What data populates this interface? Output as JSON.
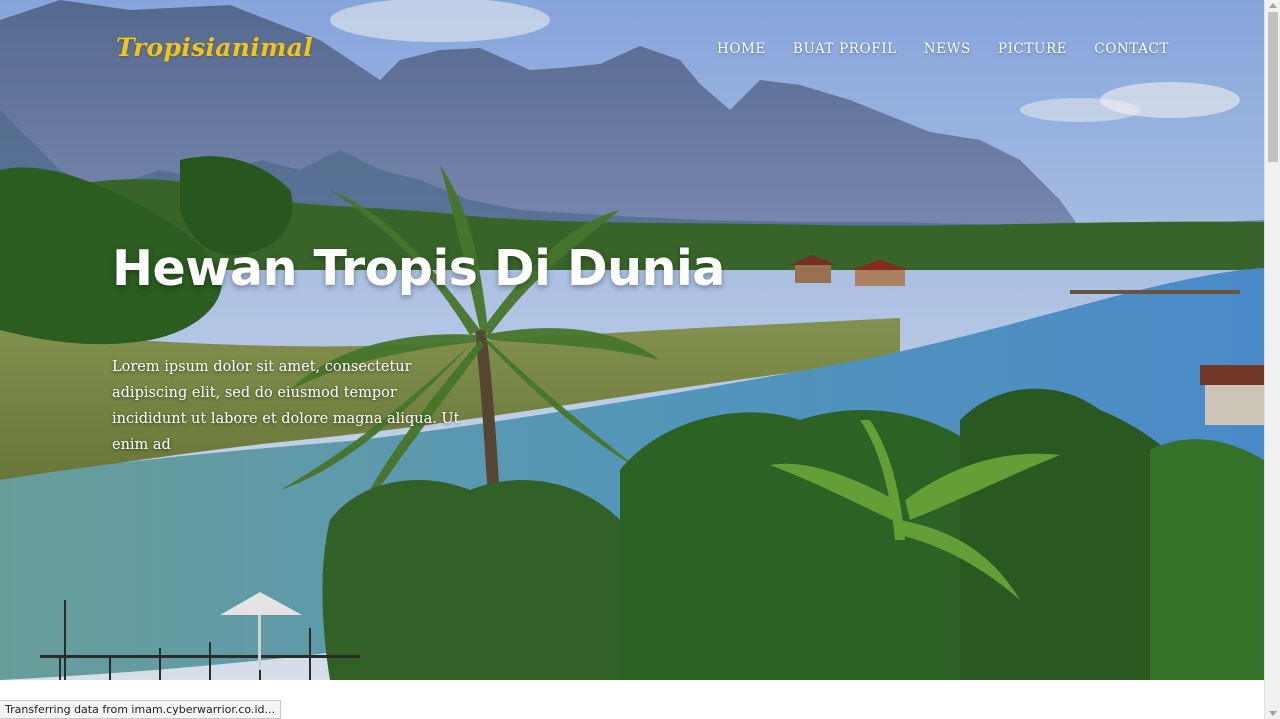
{
  "header": {
    "brand": "Tropisianimal",
    "nav": [
      {
        "id": "home",
        "label": "HOME"
      },
      {
        "id": "buat-profil",
        "label": "BUAT PROFIL"
      },
      {
        "id": "news",
        "label": "NEWS"
      },
      {
        "id": "picture",
        "label": "PICTURE"
      },
      {
        "id": "contact",
        "label": "CONTACT"
      }
    ]
  },
  "hero": {
    "title": "Hewan Tropis Di Dunia",
    "text": "Lorem ipsum dolor sit amet, consectetur adipiscing elit, sed do eiusmod tempor incididunt ut labore et dolore magna aliqua. Ut enim ad"
  },
  "status": {
    "text": "Transferring data from imam.cyberwarrior.co.id..."
  },
  "colors": {
    "brand": "#f0c419",
    "nav_text": "#ffffff",
    "sky": "#9bb7e8",
    "river": "#5f9ecf",
    "foliage": "#3f7a2a"
  }
}
